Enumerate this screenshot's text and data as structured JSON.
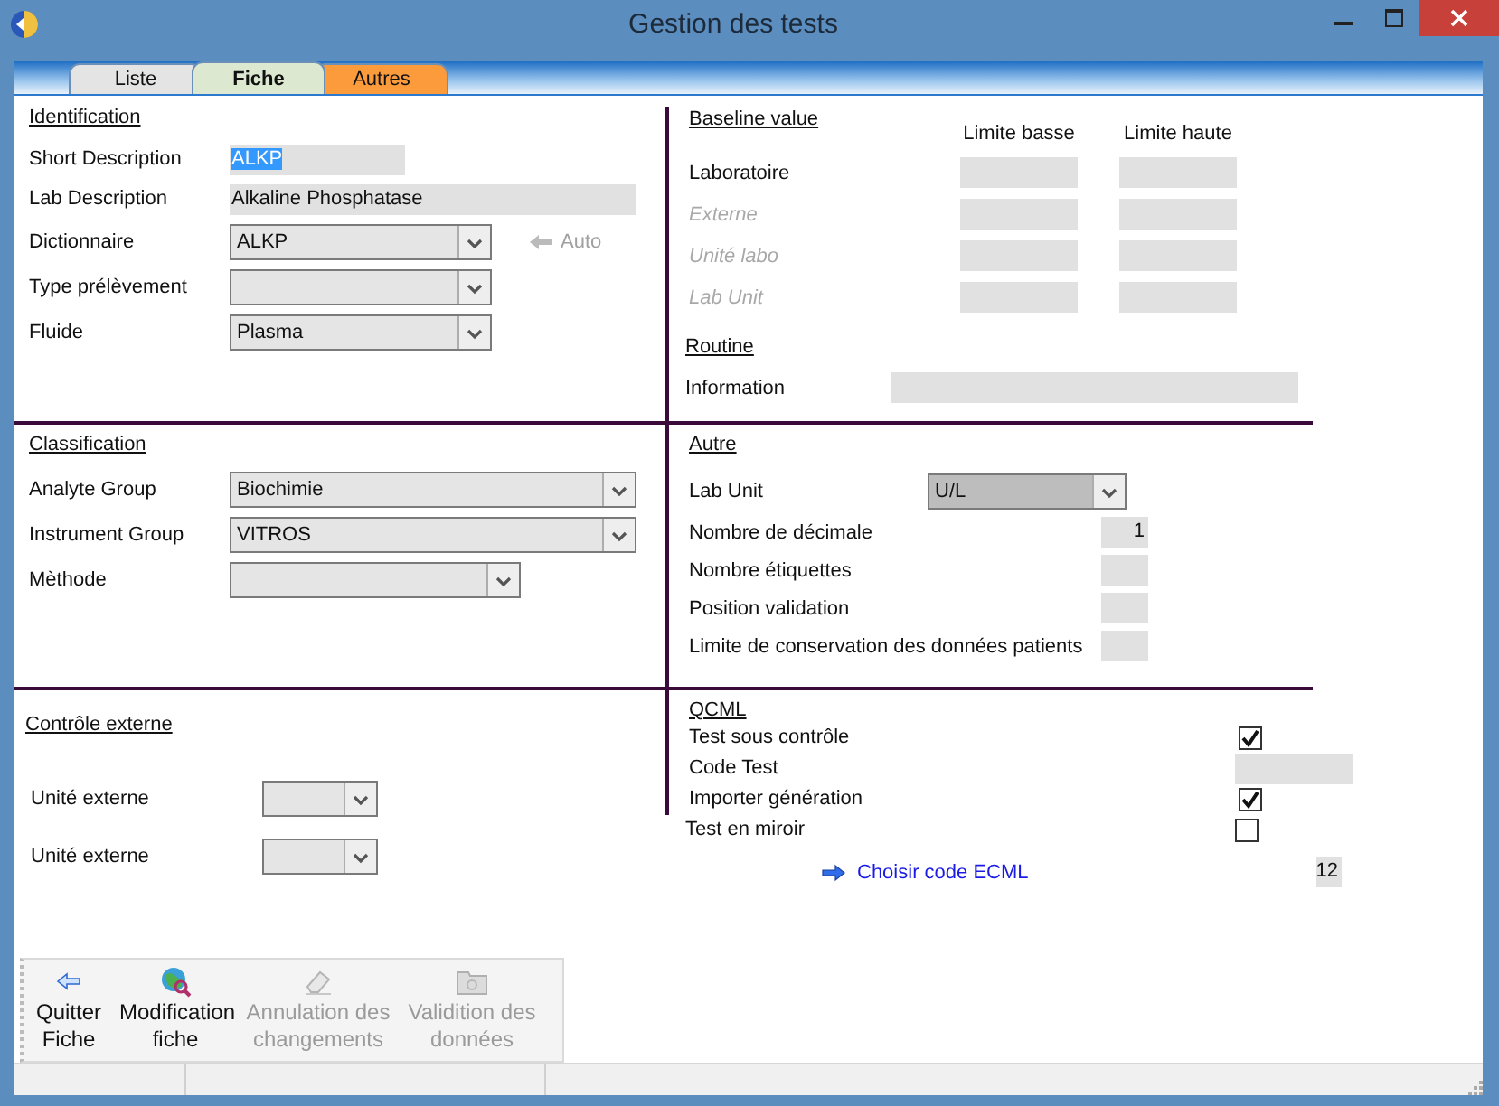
{
  "window": {
    "title": "Gestion des tests"
  },
  "tabs": [
    {
      "label": "Liste",
      "selected": false,
      "color": "#e4e4e4"
    },
    {
      "label": "Fiche",
      "selected": true,
      "color": "#dce8d0"
    },
    {
      "label": "Autres",
      "selected": false,
      "color": "#fb9b3c"
    }
  ],
  "identification": {
    "title": "Identification",
    "fields": [
      {
        "label": "Short Description",
        "kind": "text",
        "value": "ALKP",
        "highlighted": true
      },
      {
        "label": "Lab Description",
        "kind": "text",
        "value": "Alkaline Phosphatase",
        "highlighted": false
      },
      {
        "label": "Dictionnaire",
        "kind": "combo",
        "value": "ALKP",
        "action": {
          "label": "Auto",
          "disabled": true
        }
      },
      {
        "label": "Type prélèvement",
        "kind": "combo"
      },
      {
        "label": "Fluide",
        "kind": "combo",
        "value": "Plasma"
      }
    ]
  },
  "baseline": {
    "title": "Baseline value",
    "columns": [
      "Limite basse",
      "Limite haute"
    ],
    "rows": [
      {
        "label": "Laboratoire",
        "disabled": false
      },
      {
        "label": "Externe",
        "disabled": true
      },
      {
        "label": "Unité labo",
        "disabled": true
      },
      {
        "label": "Lab Unit",
        "disabled": true
      }
    ]
  },
  "routine": {
    "title": "Routine",
    "fields": [
      {
        "label": "Information",
        "kind": "text"
      }
    ]
  },
  "classification": {
    "title": "Classification",
    "fields": [
      {
        "label": "Analyte Group",
        "kind": "combo",
        "value": "Biochimie"
      },
      {
        "label": "Instrument Group",
        "kind": "combo",
        "value": "VITROS"
      },
      {
        "label": "Mèthode",
        "kind": "combo"
      }
    ]
  },
  "autre": {
    "title": "Autre",
    "fields": [
      {
        "label": "Lab Unit",
        "kind": "combo",
        "value": "U/L",
        "focused": true
      },
      {
        "label": "Nombre de décimale",
        "kind": "number",
        "value": "1"
      },
      {
        "label": "Nombre étiquettes",
        "kind": "number"
      },
      {
        "label": "Position validation",
        "kind": "number"
      },
      {
        "label": "Limite de conservation des données patients",
        "kind": "number"
      }
    ]
  },
  "controle_externe": {
    "title": "Contrôle externe",
    "fields": [
      {
        "label": "Unité externe",
        "kind": "combo"
      },
      {
        "label": "Unité externe",
        "kind": "combo"
      }
    ]
  },
  "qcml": {
    "title": "QCML",
    "fields": [
      {
        "label": "Test sous contrôle",
        "kind": "checkbox",
        "checked": true
      },
      {
        "label": "Code Test",
        "kind": "text"
      },
      {
        "label": "Importer génération",
        "kind": "checkbox",
        "checked": true
      },
      {
        "label": "Test en miroir",
        "kind": "checkbox",
        "checked": false
      }
    ],
    "link": {
      "label": "Choisir code ECML",
      "value": "12"
    }
  },
  "toolbar": [
    {
      "label": "Quitter Fiche",
      "kind": "back",
      "disabled": false
    },
    {
      "label": "Modification fiche",
      "kind": "globe",
      "disabled": false
    },
    {
      "label": "Annulation des changements",
      "kind": "eraser",
      "disabled": true
    },
    {
      "label": "Validition des données",
      "kind": "folder",
      "disabled": true
    }
  ]
}
